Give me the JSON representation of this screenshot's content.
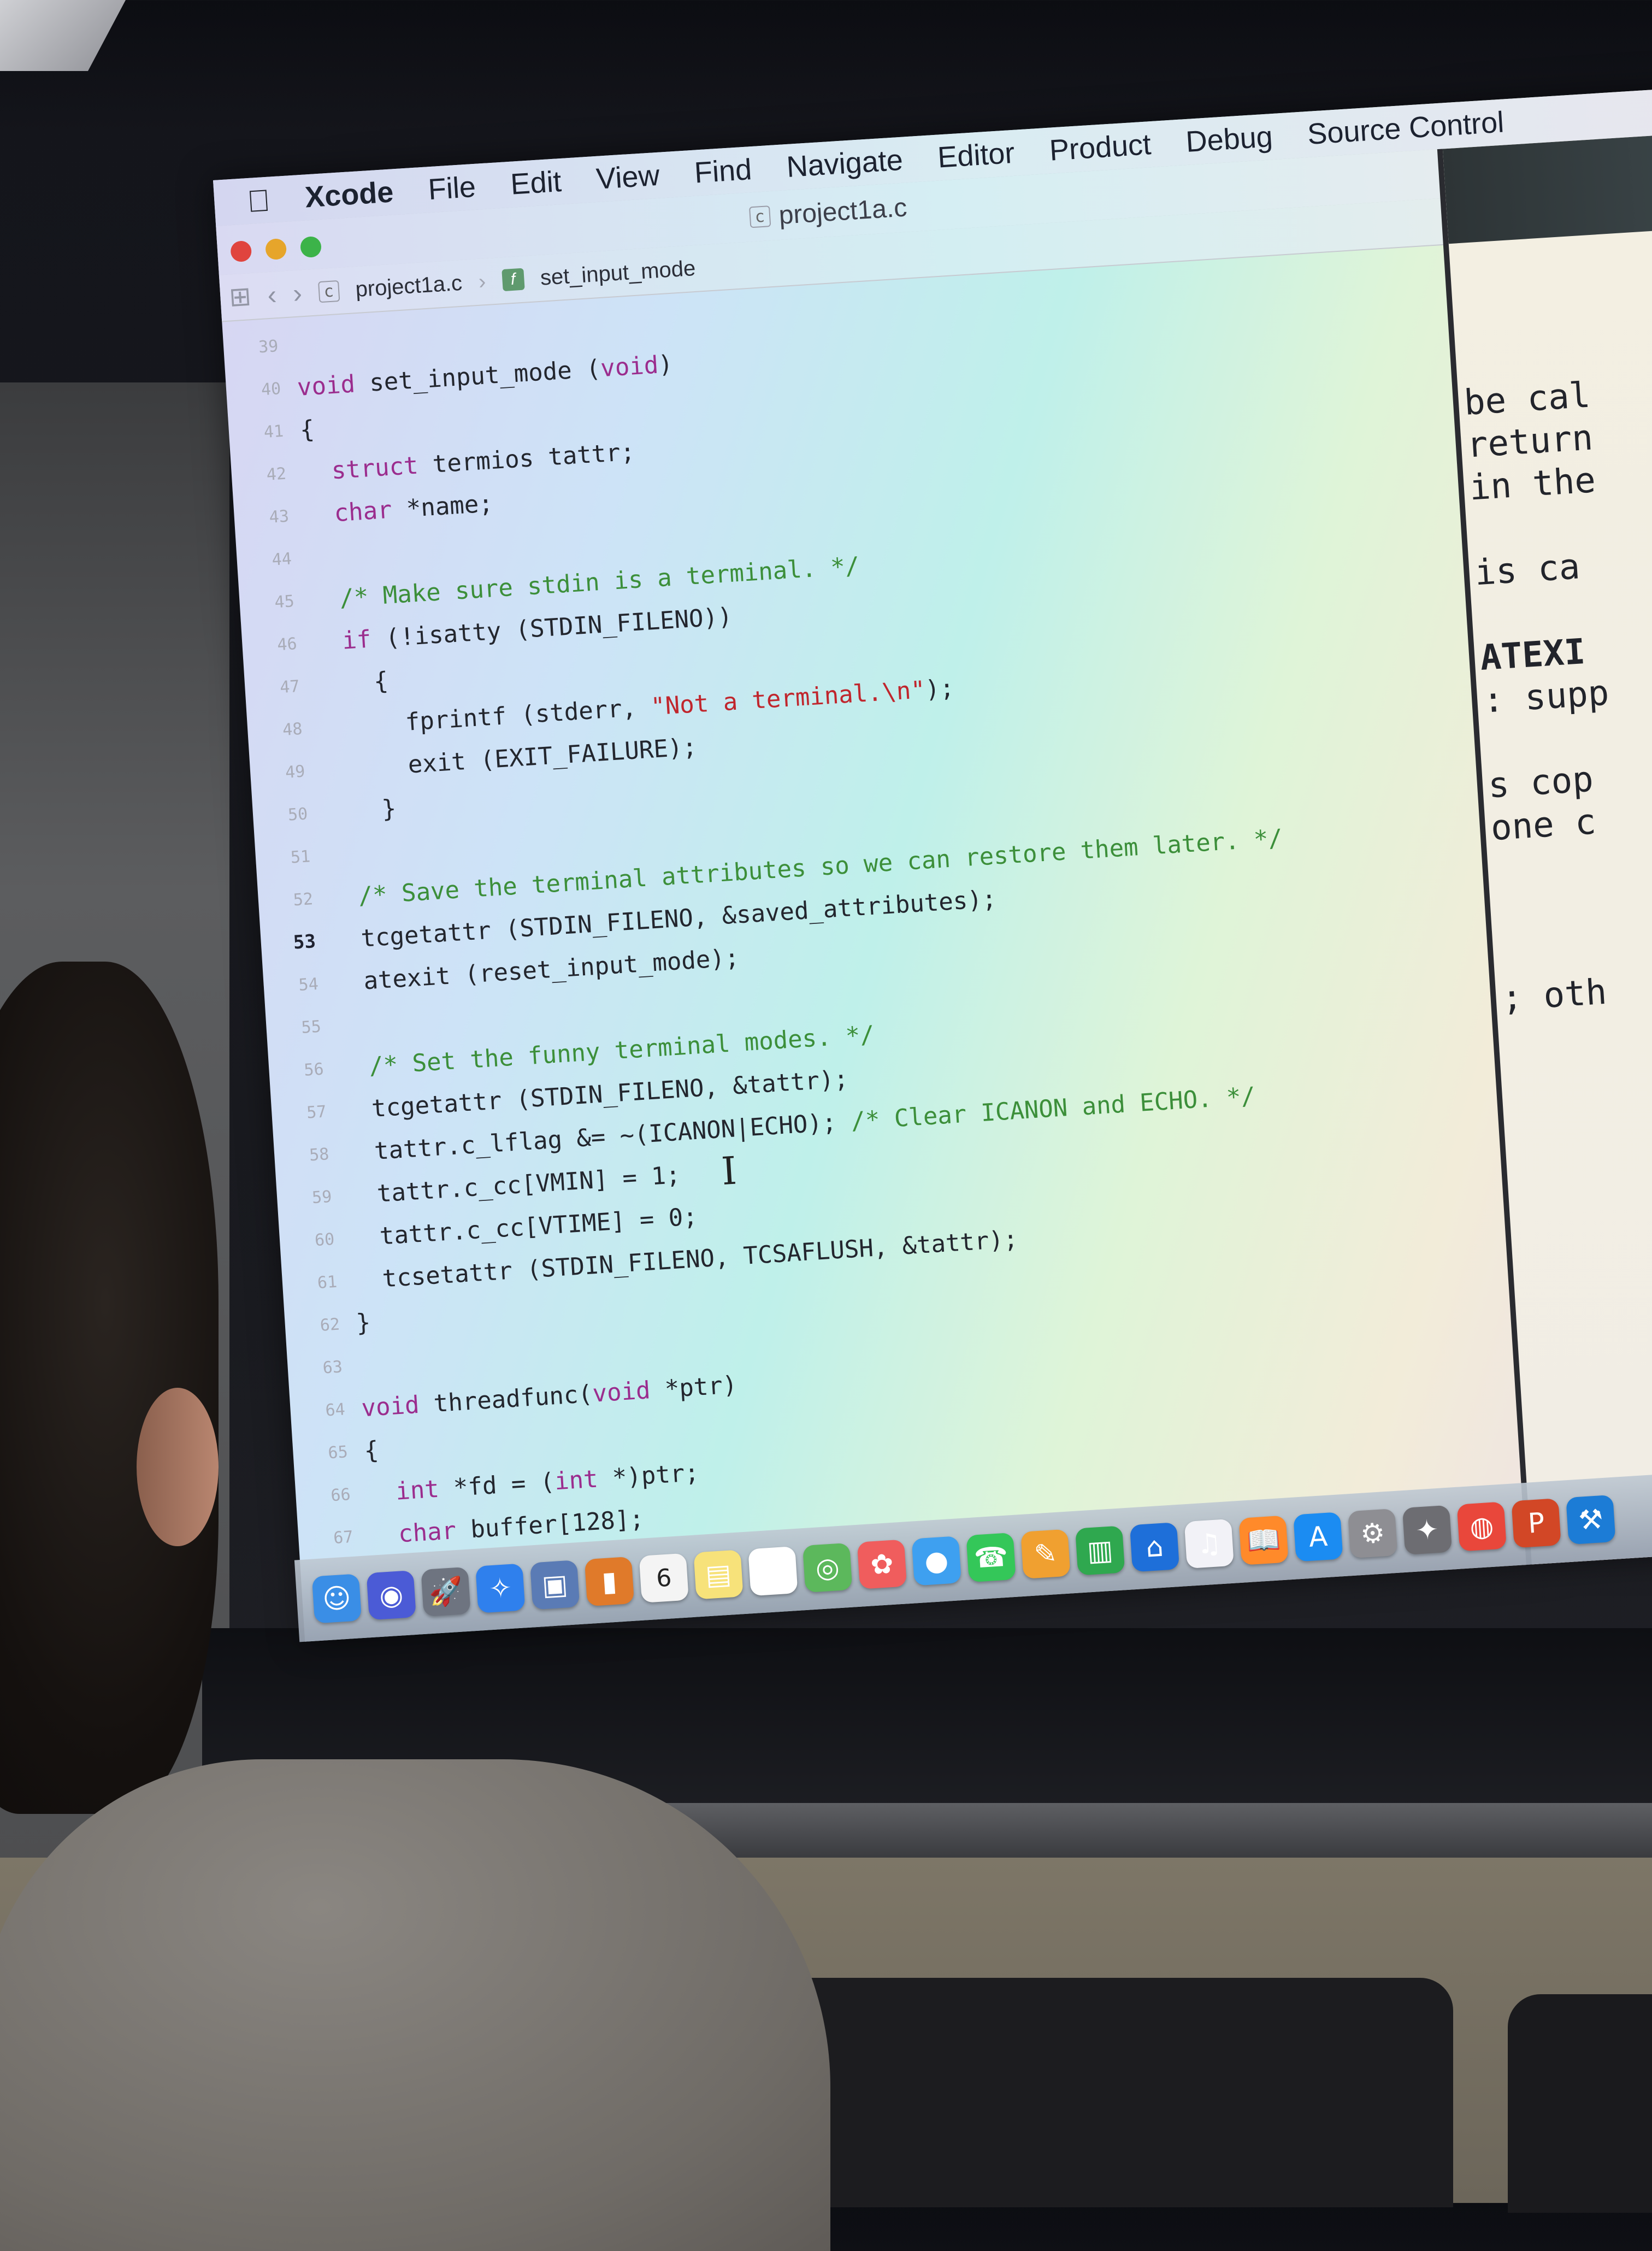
{
  "menubar": {
    "app_name": "Xcode",
    "items": [
      "File",
      "Edit",
      "View",
      "Find",
      "Navigate",
      "Editor",
      "Product",
      "Debug",
      "Source Control"
    ]
  },
  "window": {
    "title": "project1a.c",
    "file_badge": "c"
  },
  "jumpbar": {
    "file": "project1a.c",
    "function": "set_input_mode",
    "function_badge": "f"
  },
  "code": {
    "active_line": "53",
    "lines": [
      {
        "n": "39",
        "text": ""
      },
      {
        "n": "40",
        "text": "void set_input_mode (void)"
      },
      {
        "n": "41",
        "text": "{"
      },
      {
        "n": "42",
        "text": "  struct termios tattr;"
      },
      {
        "n": "43",
        "text": "  char *name;"
      },
      {
        "n": "44",
        "text": ""
      },
      {
        "n": "45",
        "text": "  /* Make sure stdin is a terminal. */"
      },
      {
        "n": "46",
        "text": "  if (!isatty (STDIN_FILENO))"
      },
      {
        "n": "47",
        "text": "    {"
      },
      {
        "n": "48",
        "text": "      fprintf (stderr, \"Not a terminal.\\n\");"
      },
      {
        "n": "49",
        "text": "      exit (EXIT_FAILURE);"
      },
      {
        "n": "50",
        "text": "    }"
      },
      {
        "n": "51",
        "text": ""
      },
      {
        "n": "52",
        "text": "  /* Save the terminal attributes so we can restore them later. */"
      },
      {
        "n": "53",
        "text": "  tcgetattr (STDIN_FILENO, &saved_attributes);"
      },
      {
        "n": "54",
        "text": "  atexit (reset_input_mode);"
      },
      {
        "n": "55",
        "text": ""
      },
      {
        "n": "56",
        "text": "  /* Set the funny terminal modes. */"
      },
      {
        "n": "57",
        "text": "  tcgetattr (STDIN_FILENO, &tattr);"
      },
      {
        "n": "58",
        "text": "  tattr.c_lflag &= ~(ICANON|ECHO); /* Clear ICANON and ECHO. */"
      },
      {
        "n": "59",
        "text": "  tattr.c_cc[VMIN] = 1;"
      },
      {
        "n": "60",
        "text": "  tattr.c_cc[VTIME] = 0;"
      },
      {
        "n": "61",
        "text": "  tcsetattr (STDIN_FILENO, TCSAFLUSH, &tattr);"
      },
      {
        "n": "62",
        "text": "}"
      },
      {
        "n": "63",
        "text": ""
      },
      {
        "n": "64",
        "text": "void threadfunc(void *ptr)"
      },
      {
        "n": "65",
        "text": "{"
      },
      {
        "n": "66",
        "text": "  int *fd = (int *)ptr;"
      },
      {
        "n": "67",
        "text": "  char buffer[128];"
      }
    ]
  },
  "doc_pane": {
    "lines": [
      "be cal",
      "return",
      "in the",
      "",
      "is ca",
      "",
      "ATEXI",
      ": supp",
      "",
      "s cop",
      "one c",
      "",
      "",
      "",
      "; oth"
    ]
  },
  "dock": {
    "calendar_day": "6",
    "icons": [
      "finder-icon",
      "siri-icon",
      "launchpad-icon",
      "safari-icon",
      "photo-booth-icon",
      "books-icon",
      "calendar-icon",
      "notes-icon",
      "reminders-icon",
      "maps-icon",
      "photos-icon",
      "messages-icon",
      "facetime-icon",
      "pages-icon",
      "numbers-icon",
      "keynote-icon",
      "itunes-icon",
      "ibooks-icon",
      "app-store-icon",
      "system-preferences-icon",
      "instruments-icon",
      "chrome-icon",
      "powerpoint-icon",
      "xcode-icon"
    ]
  },
  "colors": {
    "keyword": "#9b2d8e",
    "comment": "#3c8f3a",
    "string": "#c0262d"
  }
}
